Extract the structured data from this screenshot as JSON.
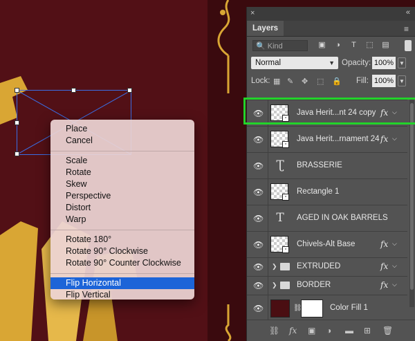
{
  "context_menu": {
    "groups": [
      [
        "Place",
        "Cancel"
      ],
      [
        "Scale",
        "Rotate",
        "Skew",
        "Perspective",
        "Distort",
        "Warp"
      ],
      [
        "Rotate 180°",
        "Rotate 90° Clockwise",
        "Rotate 90° Counter Clockwise"
      ],
      [
        "Flip Horizontal",
        "Flip Vertical"
      ]
    ],
    "selected": "Flip Horizontal"
  },
  "panel": {
    "close_glyph": "×",
    "collapse_glyph": "«",
    "tab_label": "Layers",
    "menu_glyph": "≡",
    "filter": {
      "kind_label": "Kind"
    },
    "blend_mode": "Normal",
    "opacity_label": "Opacity:",
    "opacity_value": "100%",
    "lock_label": "Lock:",
    "fill_label": "Fill:",
    "fill_value": "100%",
    "layers": [
      {
        "name": "Java Herit...nt 24 copy",
        "type": "smart",
        "fx": true,
        "highlighted": true
      },
      {
        "name": "Java Herit...rnament 24",
        "type": "smart",
        "fx": true
      },
      {
        "name": "BRASSERIE",
        "type": "text-warped"
      },
      {
        "name": "Rectangle 1",
        "type": "smart"
      },
      {
        "name": "AGED IN OAK BARRELS",
        "type": "text"
      },
      {
        "name": "Chivels-Alt Base",
        "type": "smart",
        "fx": true
      },
      {
        "name": "EXTRUDED",
        "type": "group",
        "fx": true
      },
      {
        "name": "BORDER",
        "type": "group",
        "fx": true
      },
      {
        "name": "Color Fill 1",
        "type": "fill"
      }
    ]
  },
  "colors": {
    "canvas_bg": "#521016",
    "gold": "#d9a634",
    "menu_selection": "#1c64d8",
    "highlight_border": "#22d32a",
    "panel_bg": "#535353"
  }
}
